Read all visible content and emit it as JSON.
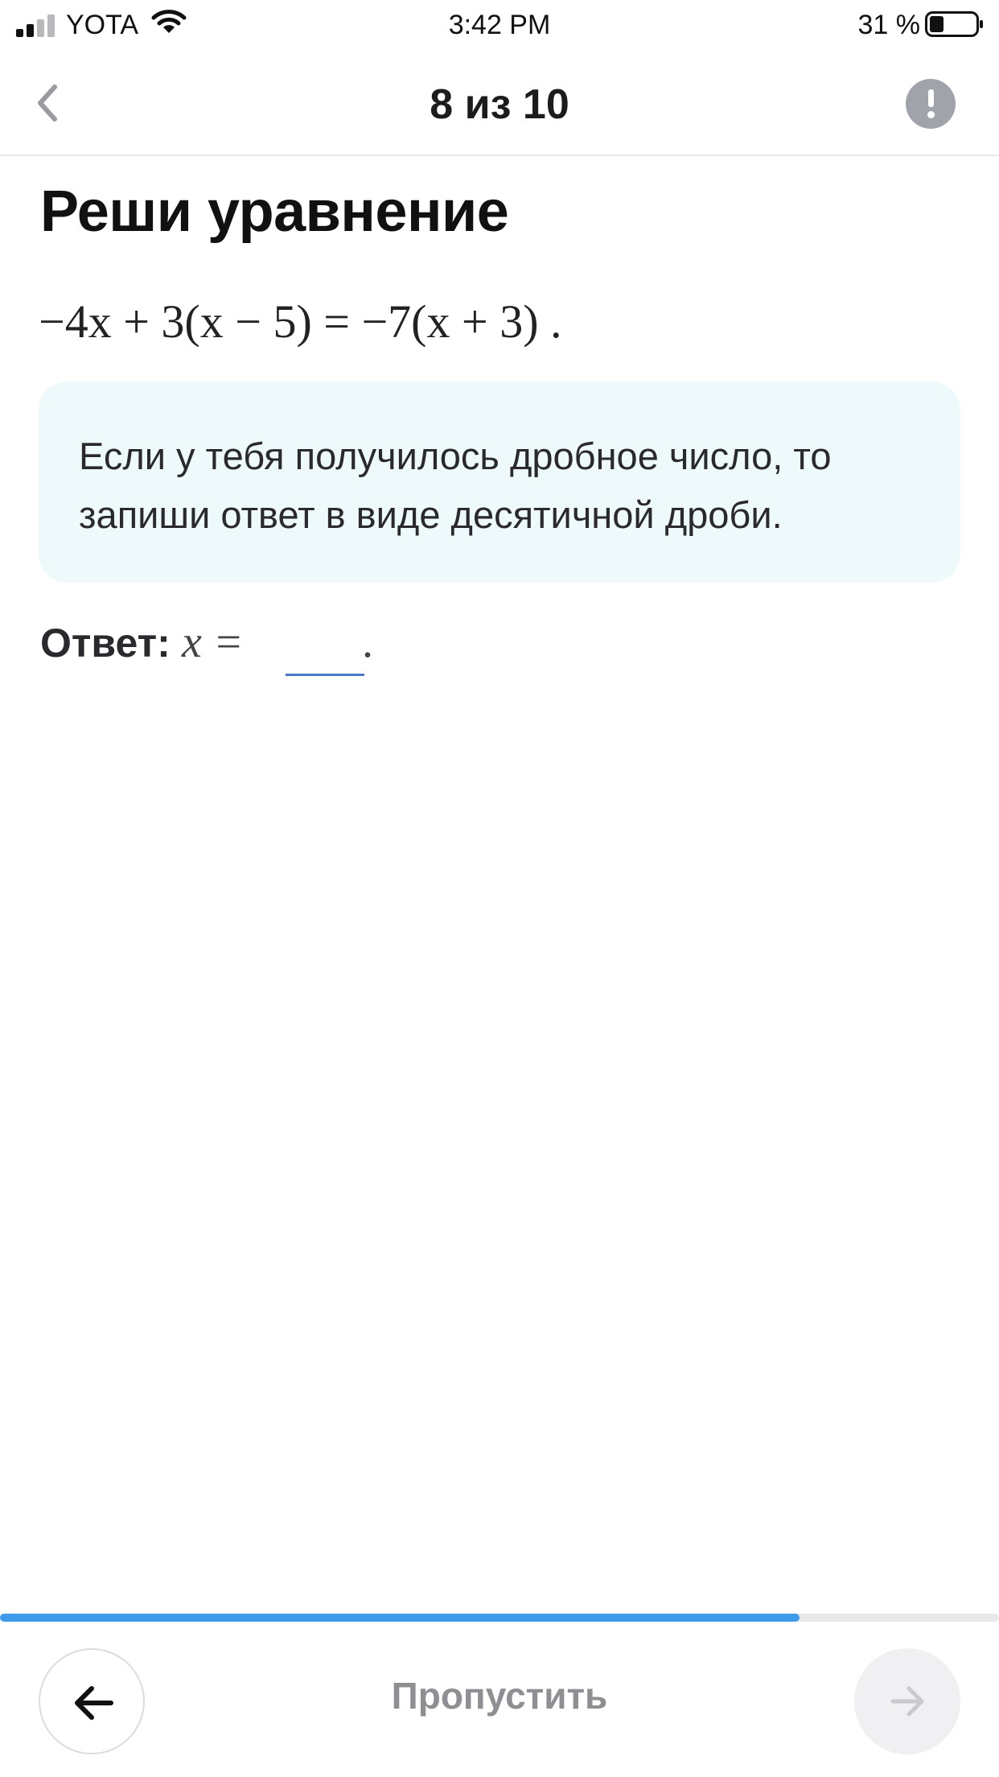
{
  "status_bar": {
    "carrier": "YOTA",
    "time": "3:42 PM",
    "battery": "31 %"
  },
  "nav": {
    "title": "8 из 10",
    "back_icon": "chevron-left-icon",
    "report_icon": "exclamation-circle-icon"
  },
  "task": {
    "title": "Реши уравнение",
    "equation": "−4x + 3(x − 5) = −7(x + 3) .",
    "hint": "Если у тебя получилось дробное число, то запиши ответ в виде десятичной дроби.",
    "answer_label": "Ответ:",
    "answer_var": "x =",
    "answer_value": "",
    "answer_end": "."
  },
  "progress": {
    "fraction": 0.8
  },
  "footer": {
    "prev_icon": "arrow-left-icon",
    "skip_label": "Пропустить",
    "next_icon": "arrow-right-icon"
  },
  "colors": {
    "accent": "#3d9be9",
    "hint_bg": "#eef9fb",
    "input_underline": "#4a78c9",
    "muted": "#8e8e93"
  }
}
